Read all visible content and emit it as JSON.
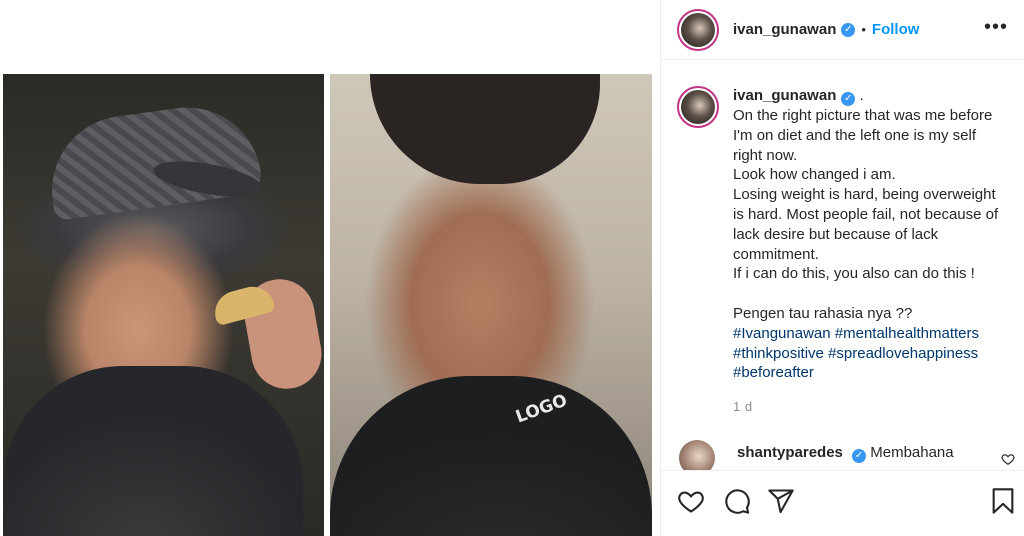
{
  "post": {
    "username": "ivan_gunawan",
    "follow_label": "Follow",
    "dot": "•",
    "verified_glyph": "✓",
    "more_glyph": "•••"
  },
  "caption": {
    "username": "ivan_gunawan",
    "trailing": " .",
    "lines": [
      "On the right picture that was me before",
      "I'm on diet and the left one is my self",
      "right now.",
      "Look how changed i am.",
      "Losing weight is hard, being overweight",
      "is hard. Most people fail, not because of",
      "lack desire but because of lack",
      "commitment.",
      "If i can do this, you also can do this !"
    ],
    "question": "Pengen tau rahasia nya ??",
    "hashtags_line1": [
      "#Ivangunawan",
      "#mentalhealthmatters"
    ],
    "hashtags_line2": [
      "#thinkpositive",
      "#spreadlovehappiness"
    ],
    "hashtags_line3": [
      "#beforeafter"
    ],
    "timestamp": "1 d"
  },
  "comment": {
    "username": "shantyparedes",
    "text": "Membahana"
  },
  "photos": {
    "right_logo": "LOGO"
  },
  "icons": {
    "like": "heart-icon",
    "comment": "comment-icon",
    "share": "share-icon",
    "save": "bookmark-icon",
    "more": "more-icon"
  },
  "colors": {
    "accent": "#0095f6",
    "hashtag": "#00376b",
    "verified": "#3897f0"
  }
}
